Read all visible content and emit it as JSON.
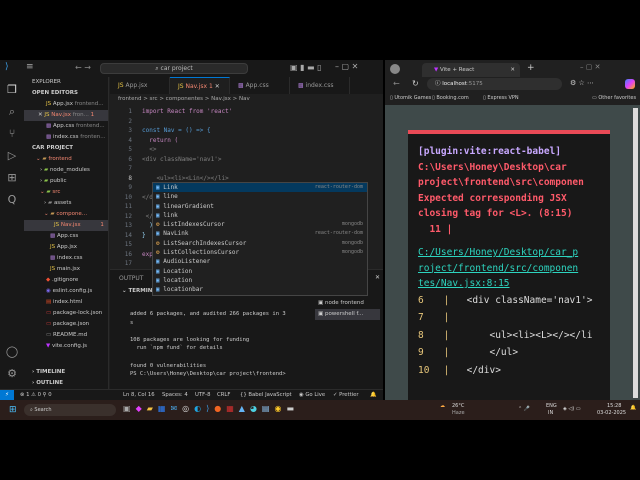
{
  "vscode": {
    "search": "car project",
    "explorer_title": "EXPLORER",
    "open_editors_title": "OPEN EDITORS",
    "open_editors": [
      {
        "name": "App.jsx",
        "dir": "frontend..."
      },
      {
        "name": "Nav.jsx",
        "dir": "fron...",
        "badge": "1"
      },
      {
        "name": "App.css",
        "dir": "frontend..."
      },
      {
        "name": "index.css",
        "dir": "fronten..."
      }
    ],
    "project_title": "CAR PROJECT",
    "tree": [
      "frontend",
      "node_modules",
      "public",
      "src",
      "assets",
      "compone...",
      "Nav.jsx",
      "App.css",
      "App.jsx",
      "index.css",
      "main.jsx",
      ".gitignore",
      "eslint.config.js",
      "index.html",
      "package-lock.json",
      "package.json",
      "README.md",
      "vite.config.js"
    ],
    "nav_badge": "1",
    "timeline": "TIMELINE",
    "outline": "OUTLINE",
    "tabs": [
      "App.jsx",
      "Nav.jsx",
      "App.css",
      "index.css"
    ],
    "active_tab_badge": "1",
    "breadcrumb": "frontend > src > componentes > Nav.jsx > Nav",
    "code": [
      {
        "n": "1",
        "t": "import React from 'react'"
      },
      {
        "n": "2",
        "t": ""
      },
      {
        "n": "3",
        "t": "const Nav = () => {"
      },
      {
        "n": "4",
        "t": "  return ("
      },
      {
        "n": "5",
        "t": "  <>"
      },
      {
        "n": "6",
        "t": "<div className='nav1'>"
      },
      {
        "n": "7",
        "t": ""
      },
      {
        "n": "8",
        "t": "    <ul><li><Lin</></li>"
      },
      {
        "n": "9",
        "t": ""
      },
      {
        "n": "10",
        "t": "</d"
      },
      {
        "n": "11",
        "t": ""
      },
      {
        "n": "12",
        "t": " </"
      },
      {
        "n": "13",
        "t": "  )"
      },
      {
        "n": "14",
        "t": "}"
      },
      {
        "n": "15",
        "t": ""
      },
      {
        "n": "16",
        "t": "exp"
      },
      {
        "n": "17",
        "t": ""
      }
    ],
    "autocomplete": [
      {
        "label": "Link",
        "src": "react-router-dom"
      },
      {
        "label": "line",
        "src": ""
      },
      {
        "label": "linearGradient",
        "src": ""
      },
      {
        "label": "link",
        "src": ""
      },
      {
        "label": "ListIndexesCursor",
        "src": "mongodb"
      },
      {
        "label": "NavLink",
        "src": "react-router-dom"
      },
      {
        "label": "ListSearchIndexesCursor",
        "src": "mongodb"
      },
      {
        "label": "ListCollectionsCursor",
        "src": "mongodb"
      },
      {
        "label": "AudioListener",
        "src": ""
      },
      {
        "label": "Location",
        "src": ""
      },
      {
        "label": "location",
        "src": ""
      },
      {
        "label": "locationbar",
        "src": ""
      }
    ],
    "panel_tabs": [
      "OUTPUT",
      "TERMINAL"
    ],
    "terminals": [
      "node frontend",
      "powershell f..."
    ],
    "terminal_text": "added 6 packages, and audited 266 packages in 3\ns\n\n108 packages are looking for funding\n  run `npm fund` for details\n\nfound 0 vulnerabilities\nPS C:\\Users\\Honey\\Desktop\\car project\\frontend>",
    "status": {
      "errors": "1",
      "warnings": "0",
      "ports": "0",
      "pos": "Ln 8, Col 16",
      "spaces": "Spaces: 4",
      "enc": "UTF-8",
      "eol": "CRLF",
      "lang": "{} Babel JavaScript",
      "golive": "Go Live",
      "prettier": "Prettier"
    }
  },
  "browser": {
    "tab": "Vite + React",
    "url": "localhost",
    "port": ":5175",
    "bookmarks": [
      "Utomik Games",
      "Booking.com",
      "Express VPN"
    ],
    "other_favorites": "Other favorites",
    "error": {
      "plugin": "[plugin:vite:react-babel]",
      "message": "C:\\Users\\Honey\\Desktop\\car\nproject\\frontend\\src\\componen\nExpected corresponding JSX\nclosing tag for <L>. (8:15)\n  11 |",
      "link": "C:/Users/Honey/Desktop/car_p\nroject/frontend/src/componen\ntes/Nav.jsx:8:15",
      "frame": [
        {
          "n": "6",
          "t": "  <div className='nav1'>"
        },
        {
          "n": "7",
          "t": ""
        },
        {
          "n": "8",
          "t": "      <ul><li><L></></li"
        },
        {
          "n": "9",
          "t": "      </ul>"
        },
        {
          "n": "10",
          "t": "  </div>"
        }
      ]
    }
  },
  "taskbar": {
    "search": "Search",
    "weather_temp": "26°C",
    "weather": "Haze",
    "lang1": "ENG",
    "lang2": "IN",
    "time": "15:28",
    "date": "03-02-2025"
  }
}
